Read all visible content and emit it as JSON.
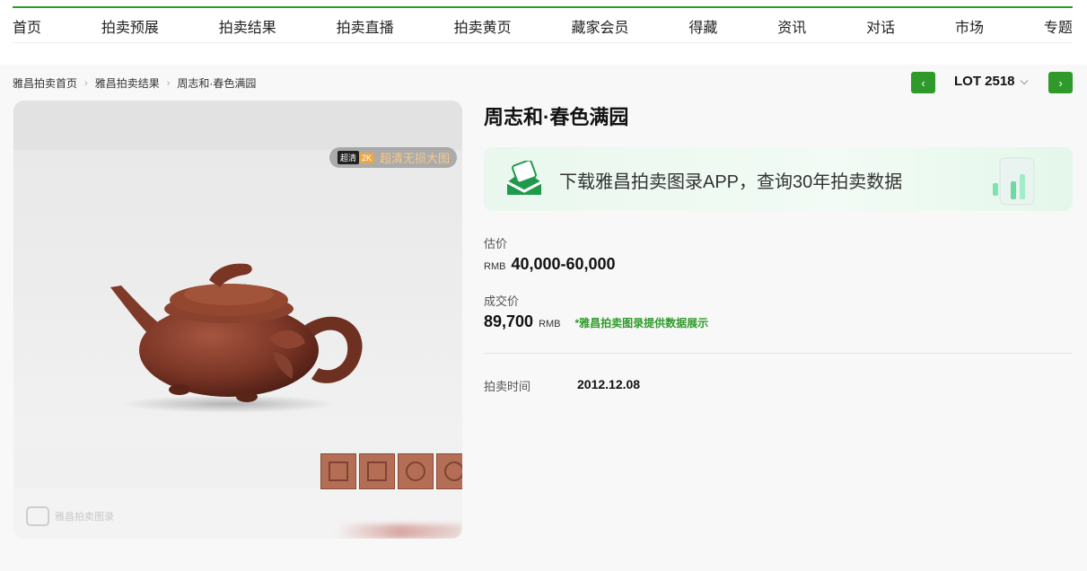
{
  "nav": {
    "items": [
      "首页",
      "拍卖预展",
      "拍卖结果",
      "拍卖直播",
      "拍卖黄页",
      "藏家会员",
      "得藏",
      "资讯",
      "对话",
      "市场",
      "专题"
    ]
  },
  "breadcrumb": [
    "雅昌拍卖首页",
    "雅昌拍卖结果",
    "周志和·春色满园"
  ],
  "lot": {
    "label": "LOT 2518",
    "prev_icon": "‹",
    "next_icon": "›"
  },
  "image": {
    "hd_tag1": "超清",
    "hd_tag2": "2K",
    "hd_text": "超清无损大图",
    "watermark": "雅昌拍卖图录"
  },
  "item": {
    "title": "周志和·春色满园"
  },
  "banner": {
    "text": "下载雅昌拍卖图录APP，查询30年拍卖数据"
  },
  "estimate": {
    "label": "估价",
    "currency": "RMB",
    "value": "40,000-60,000"
  },
  "sold": {
    "label": "成交价",
    "value": "89,700",
    "currency": "RMB",
    "note": "*雅昌拍卖图录提供数据展示"
  },
  "auction_time": {
    "label": "拍卖时间",
    "value": "2012.12.08"
  },
  "colors": {
    "accent": "#2f9a2a",
    "note": "#2f9a2a"
  }
}
